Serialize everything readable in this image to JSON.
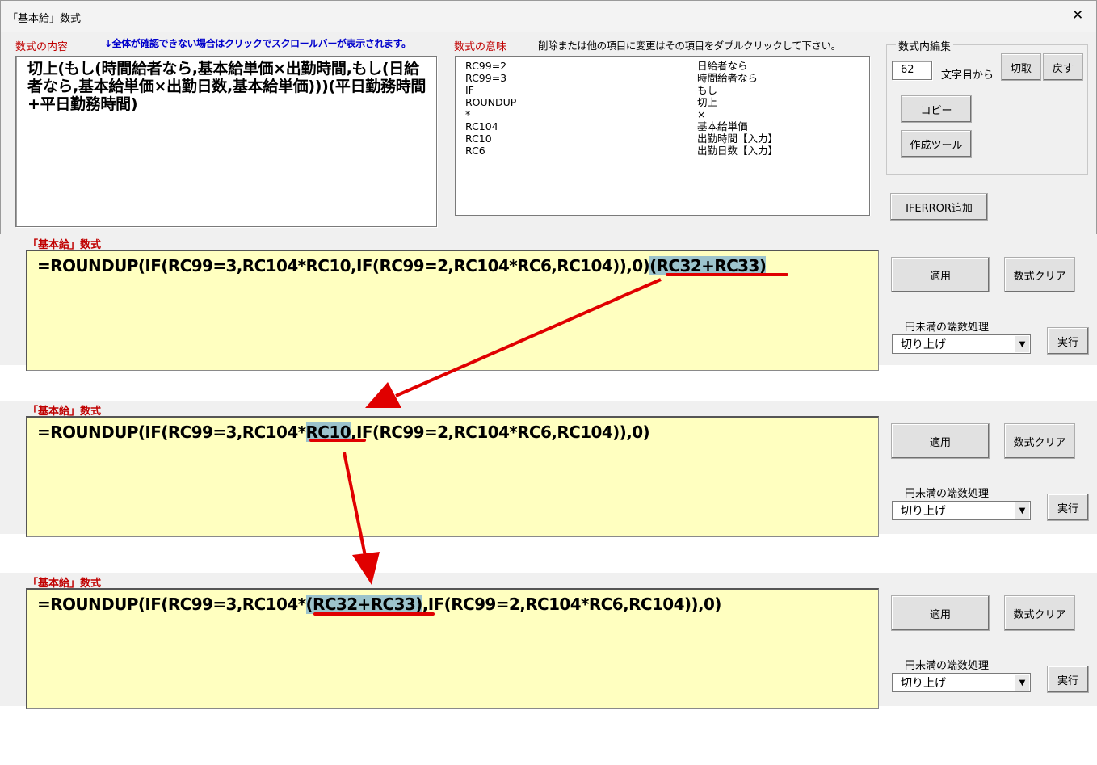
{
  "window": {
    "title": "「基本給」数式",
    "close_glyph": "✕"
  },
  "content_section": {
    "label": "数式の内容",
    "hint": "↓全体が確認できない場合はクリックでスクロールバーが表示されます。",
    "text": "切上(もし(時間給者なら,基本給単価×出勤時間,もし(日給者なら,基本給単価×出勤日数,基本給単価)))(平日勤務時間+平日勤務時間)"
  },
  "meaning_section": {
    "label": "数式の意味",
    "hint": "削除または他の項目に変更はその項目をダブルクリックして下さい。",
    "items": [
      {
        "code": "RC99=2",
        "meaning": "日給者なら"
      },
      {
        "code": "RC99=3",
        "meaning": "時間給者なら"
      },
      {
        "code": "IF",
        "meaning": "もし"
      },
      {
        "code": "ROUNDUP",
        "meaning": "切上"
      },
      {
        "code": "*",
        "meaning": "×"
      },
      {
        "code": "RC104",
        "meaning": "基本給単価"
      },
      {
        "code": "RC10",
        "meaning": "出勤時間【入力】"
      },
      {
        "code": "RC6",
        "meaning": "出勤日数【入力】"
      }
    ]
  },
  "edit_group": {
    "legend": "数式内編集",
    "position_value": "62",
    "position_suffix": "文字目から",
    "cut_label": "切取",
    "undo_label": "戻す",
    "copy_label": "コピー",
    "tool_label": "作成ツール"
  },
  "iferror_label": "IFERROR追加",
  "panels": [
    {
      "label": "「基本給」数式",
      "formula": {
        "before": "=ROUNDUP(IF(RC99=3,RC104*RC10,IF(RC99=2,RC104*RC6,RC104)),0)",
        "highlight": "(RC32+RC33)",
        "after": ""
      },
      "apply_label": "適用",
      "clear_label": "数式クリア",
      "rounding_label": "円未満の端数処理",
      "rounding_value": "切り上げ",
      "run_label": "実行"
    },
    {
      "label": "「基本給」数式",
      "formula": {
        "before": "=ROUNDUP(IF(RC99=3,RC104*",
        "highlight": "RC10",
        "after": ",IF(RC99=2,RC104*RC6,RC104)),0)"
      },
      "apply_label": "適用",
      "clear_label": "数式クリア",
      "rounding_label": "円未満の端数処理",
      "rounding_value": "切り上げ",
      "run_label": "実行"
    },
    {
      "label": "「基本給」数式",
      "formula": {
        "before": "=ROUNDUP(IF(RC99=3,RC104*",
        "highlight": "(RC32+RC33)",
        "after": ",IF(RC99=2,RC104*RC6,RC104)),0)"
      },
      "apply_label": "適用",
      "clear_label": "数式クリア",
      "rounding_label": "円未満の端数処理",
      "rounding_value": "切り上げ",
      "run_label": "実行"
    }
  ]
}
